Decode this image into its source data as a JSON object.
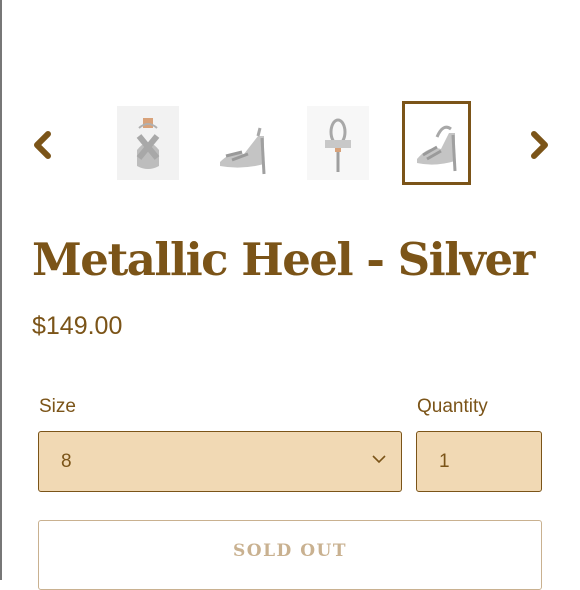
{
  "gallery": {
    "prev_icon": "chevron-left-icon",
    "next_icon": "chevron-right-icon",
    "thumbnails": [
      {
        "name": "thumb-front",
        "active": false
      },
      {
        "name": "thumb-side",
        "active": false
      },
      {
        "name": "thumb-back",
        "active": false
      },
      {
        "name": "thumb-angle",
        "active": true
      }
    ]
  },
  "product": {
    "title": "Metallic Heel - Silver",
    "price": "$149.00"
  },
  "form": {
    "size_label": "Size",
    "size_value": "8",
    "quantity_label": "Quantity",
    "quantity_value": "1",
    "sold_out_label": "SOLD OUT"
  },
  "colors": {
    "brand": "#7b5418",
    "field_bg": "#f1d9b4",
    "disabled": "#c9b190"
  }
}
